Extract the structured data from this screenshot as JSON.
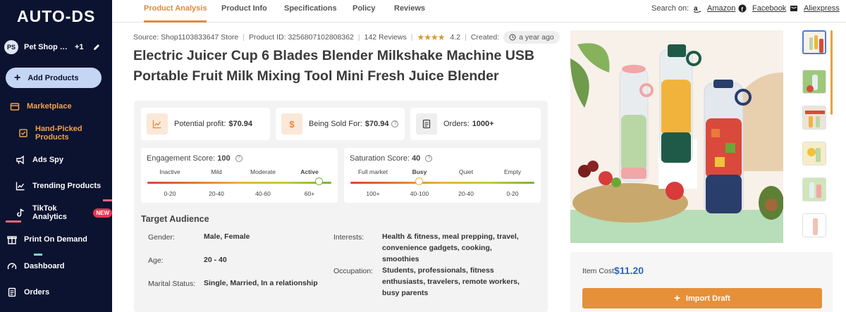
{
  "sidebar": {
    "logo": "AUTO-DS",
    "store": {
      "initials": "PS",
      "name": "Pet Shop Di...",
      "extra": "+1"
    },
    "add_products": "Add Products",
    "items": [
      {
        "label": "Marketplace",
        "icon": "store-icon"
      },
      {
        "label": "Hand-Picked Products",
        "icon": "handpicked-icon"
      },
      {
        "label": "Ads Spy",
        "icon": "megaphone-icon"
      },
      {
        "label": "Trending Products",
        "icon": "trend-icon"
      },
      {
        "label": "TikTok Analytics",
        "icon": "tiktok-icon",
        "badge": "NEW"
      },
      {
        "label": "Print On Demand",
        "icon": "gift-icon"
      },
      {
        "label": "Dashboard",
        "icon": "gauge-icon"
      },
      {
        "label": "Orders",
        "icon": "orders-icon"
      }
    ]
  },
  "tabs": [
    "Product Analysis",
    "Product Info",
    "Specifications",
    "Policy",
    "Reviews"
  ],
  "active_tab": "Product Analysis",
  "search_on": {
    "label": "Search on:",
    "links": [
      "Amazon",
      "Facebook",
      "Aliexpress"
    ]
  },
  "meta": {
    "source": "Source: Shop1103833647 Store",
    "product_id": "Product ID: 3256807102808362",
    "reviews": "142 Reviews",
    "stars": "★★★★",
    "rating": "4.2",
    "created_label": "Created:",
    "created_value": "a year ago"
  },
  "title": "Electric Juicer Cup 6 Blades Blender Milkshake Machine USB Portable Fruit Milk Mixing Tool Mini Fresh Juice Blender",
  "stats": {
    "profit_label": "Potential profit:",
    "profit_value": "$70.94",
    "sold_label": "Being Sold For:",
    "sold_value": "$70.94",
    "orders_label": "Orders:",
    "orders_value": "1000+"
  },
  "engagement": {
    "label": "Engagement Score:",
    "value": "100",
    "levels": [
      "Inactive",
      "Mild",
      "Moderate",
      "Active"
    ],
    "ranges": [
      "0-20",
      "20-40",
      "40-60",
      "60+"
    ],
    "active_level": "Active",
    "level_fraction": 0.93
  },
  "saturation": {
    "label": "Saturation Score:",
    "value": "40",
    "levels": [
      "Full market",
      "Busy",
      "Quiet",
      "Empty"
    ],
    "ranges": [
      "100+",
      "40-100",
      "20-40",
      "0-20"
    ],
    "active_level": "Busy",
    "level_fraction": 0.37
  },
  "audience": {
    "title": "Target Audience",
    "gender_label": "Gender:",
    "gender": "Male, Female",
    "age_label": "Age:",
    "age": "20 - 40",
    "marital_label": "Marital Status:",
    "marital": "Single, Married, In a relationship",
    "interests_label": "Interests:",
    "interests": "Health & fitness, meal prepping, travel, convenience gadgets, cooking, smoothies",
    "occupation_label": "Occupation:",
    "occupation": "Students, professionals, fitness enthusiasts, travelers, remote workers, busy parents"
  },
  "pricing": {
    "cost_label": "Item Cost",
    "cost_value": "$11.20",
    "import_label": "Import Draft"
  },
  "colors": {
    "accent": "#e6903a",
    "sidebar": "#0b1330",
    "price": "#2f63c6",
    "active_green": "#79b23a"
  }
}
